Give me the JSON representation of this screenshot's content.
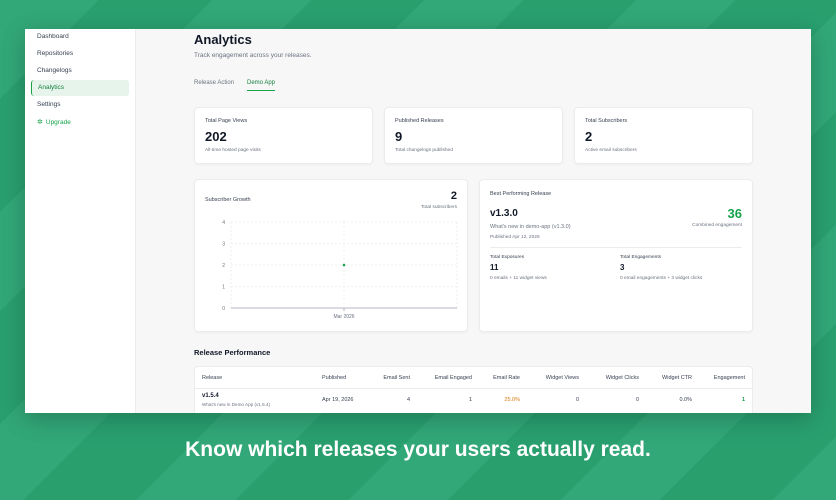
{
  "sidebar": {
    "items": [
      {
        "label": "Dashboard"
      },
      {
        "label": "Repositories"
      },
      {
        "label": "Changelogs"
      },
      {
        "label": "Analytics"
      },
      {
        "label": "Settings"
      }
    ],
    "upgrade": {
      "label": "Upgrade",
      "icon": "sparkle-icon"
    }
  },
  "header": {
    "title": "Analytics",
    "subtitle": "Track engagement across your releases."
  },
  "tabs": [
    {
      "label": "Release Action"
    },
    {
      "label": "Demo App",
      "active": true
    }
  ],
  "stats": [
    {
      "label": "Total Page Views",
      "value": "202",
      "sub": "All-time hosted page visits"
    },
    {
      "label": "Published Releases",
      "value": "9",
      "sub": "Total changelogs published"
    },
    {
      "label": "Total Subscribers",
      "value": "2",
      "sub": "Active email subscribers"
    }
  ],
  "subscriber_growth": {
    "title": "Subscriber Growth",
    "value": "2",
    "sub": "Total subscribers"
  },
  "chart_data": {
    "type": "line",
    "x": [
      "Mar 2026"
    ],
    "series": [
      {
        "values": [
          2
        ]
      }
    ],
    "ylim": [
      0,
      4
    ],
    "yticks": [
      "0",
      "1",
      "2",
      "3",
      "4"
    ],
    "xticks": [
      "Mar 2026"
    ],
    "grid": true,
    "color": "#16a34a"
  },
  "best_performing": {
    "title": "Best Performing Release",
    "version": "v1.3.0",
    "description": "What's new in demo-app (v1.3.0)",
    "published": "Published Apr 12, 2026",
    "score": "36",
    "score_label": "Combined engagement",
    "exposures_label": "Total Exposures",
    "exposures_value": "11",
    "exposures_sub": "0 emails + 11 widget views",
    "engagements_label": "Total Engagements",
    "engagements_value": "3",
    "engagements_sub": "0 email engagements + 3 widget clicks"
  },
  "release_performance": {
    "title": "Release Performance",
    "columns": [
      "Release",
      "Published",
      "Email Sent",
      "Email Engaged",
      "Email Rate",
      "Widget Views",
      "Widget Clicks",
      "Widget CTR",
      "Engagement"
    ],
    "rows": [
      {
        "version": "v1.5.4",
        "description": "What's new in Demo App (v1.5.4)",
        "published": "Apr 19, 2026",
        "email_sent": "4",
        "email_engaged": "1",
        "email_rate": "25.0%",
        "widget_views": "0",
        "widget_clicks": "0",
        "widget_ctr": "0.0%",
        "engagement": "1"
      }
    ]
  },
  "caption": "Know which releases your users actually read.",
  "colors": {
    "accent": "#16a34a",
    "background": "#2aa472",
    "rate": "#d97706"
  }
}
